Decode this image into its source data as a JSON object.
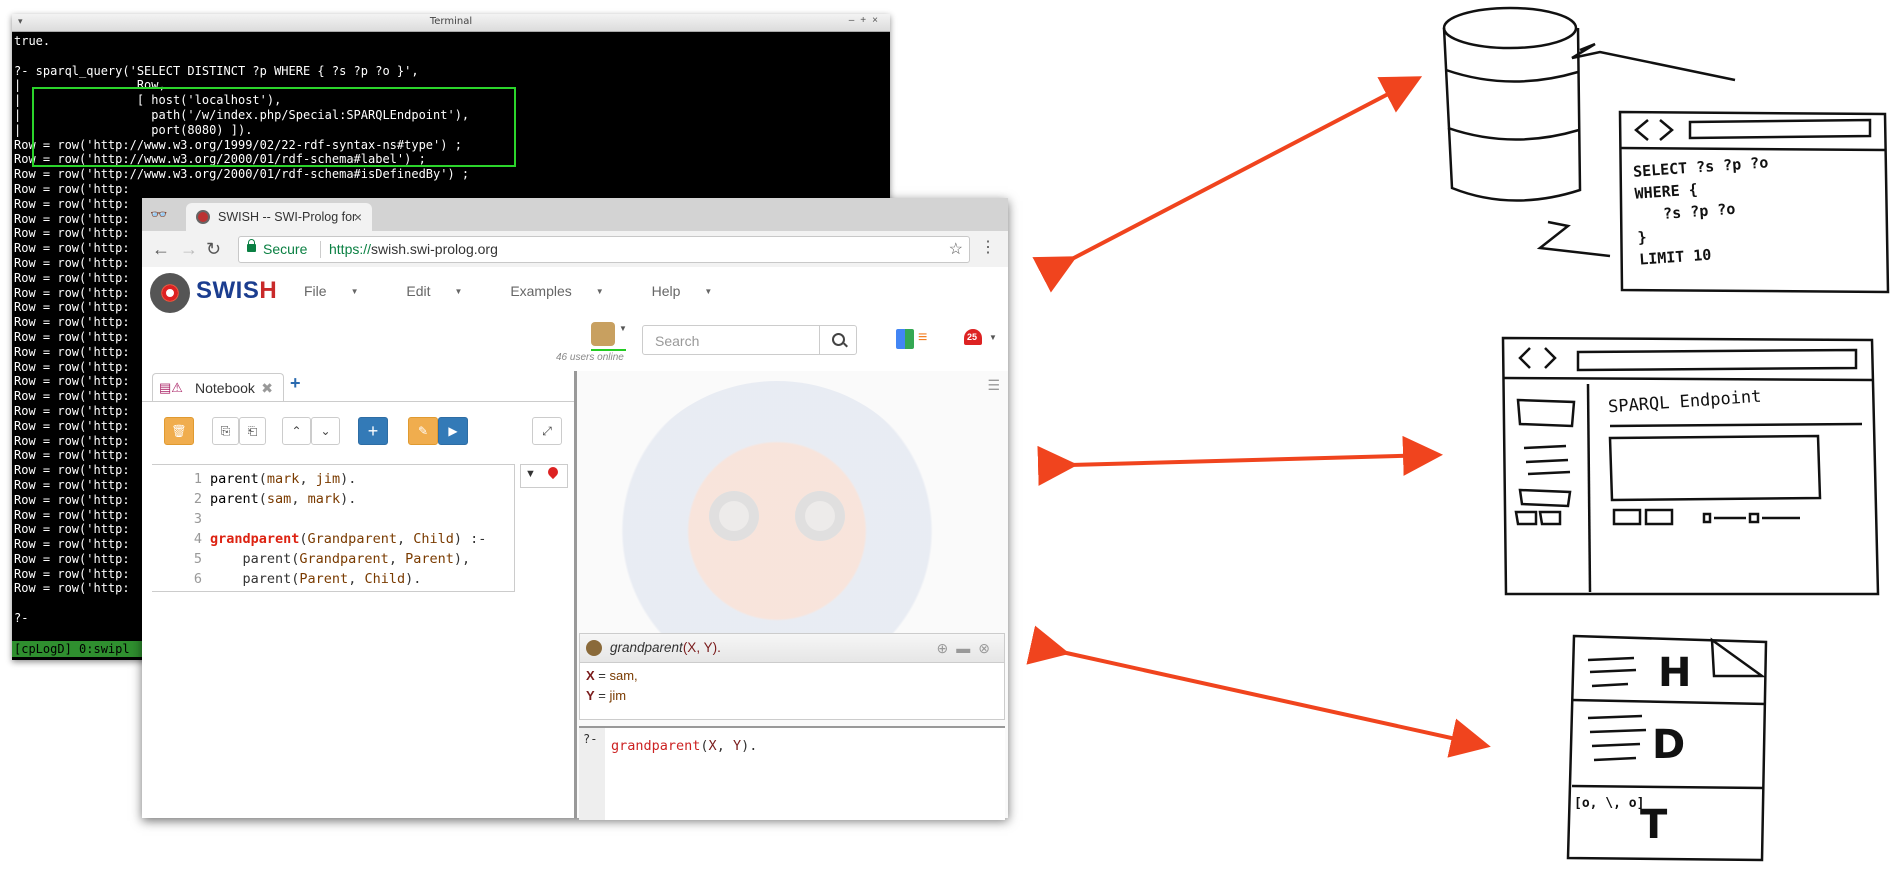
{
  "terminal": {
    "title": "Terminal",
    "lines": [
      "true.",
      "",
      "?- sparql_query('SELECT DISTINCT ?p WHERE { ?s ?p ?o }',",
      "|                Row,",
      "|                [ host('localhost'),",
      "|                  path('/w/index.php/Special:SPARQLEndpoint'),",
      "|                  port(8080) ]).",
      "Row = row('http://www.w3.org/1999/02/22-rdf-syntax-ns#type') ;",
      "Row = row('http://www.w3.org/2000/01/rdf-schema#label') ;",
      "Row = row('http://www.w3.org/2000/01/rdf-schema#isDefinedBy') ;",
      "Row = row('http:",
      "Row = row('http:",
      "Row = row('http:",
      "Row = row('http:",
      "Row = row('http:",
      "Row = row('http:",
      "Row = row('http:",
      "Row = row('http:",
      "Row = row('http:",
      "Row = row('http:",
      "Row = row('http:",
      "Row = row('http:",
      "Row = row('http:",
      "Row = row('http:",
      "Row = row('http:",
      "Row = row('http:",
      "Row = row('http:",
      "Row = row('http:",
      "Row = row('http:",
      "Row = row('http:",
      "Row = row('http:",
      "Row = row('http:",
      "Row = row('http:",
      "Row = row('http:",
      "Row = row('http:",
      "Row = row('http:",
      "Row = row('http:",
      "Row = row('http:",
      "",
      "?-"
    ],
    "status": "[cpLogD] 0:swipl"
  },
  "browser": {
    "tab_title": "SWISH -- SWI-Prolog for",
    "secure_label": "Secure",
    "url_scheme": "https://",
    "url_host": "swish.swi-prolog.org"
  },
  "swish": {
    "logo_sw": "SWIS",
    "logo_h": "H",
    "menu": [
      "File",
      "Edit",
      "Examples",
      "Help"
    ],
    "users_online": "46 users online",
    "search_placeholder": "Search",
    "notification_count": "25",
    "notebook_tab": "Notebook",
    "code": [
      {
        "n": "1",
        "parts": [
          [
            "kw-pred",
            "parent"
          ],
          [
            "atom",
            "("
          ],
          [
            "var",
            "mark"
          ],
          [
            "atom",
            ", "
          ],
          [
            "var",
            "jim"
          ],
          [
            "atom",
            ")."
          ]
        ]
      },
      {
        "n": "2",
        "parts": [
          [
            "kw-pred",
            "parent"
          ],
          [
            "atom",
            "("
          ],
          [
            "var",
            "sam"
          ],
          [
            "atom",
            ", "
          ],
          [
            "var",
            "mark"
          ],
          [
            "atom",
            ")."
          ]
        ]
      },
      {
        "n": "3",
        "parts": []
      },
      {
        "n": "4",
        "parts": [
          [
            "kw-red",
            "grandparent"
          ],
          [
            "atom",
            "("
          ],
          [
            "var",
            "Grandparent"
          ],
          [
            "atom",
            ", "
          ],
          [
            "var",
            "Child"
          ],
          [
            "atom",
            ") :-"
          ]
        ]
      },
      {
        "n": "5",
        "parts": [
          [
            "atom",
            "    parent("
          ],
          [
            "var",
            "Grandparent"
          ],
          [
            "atom",
            ", "
          ],
          [
            "var",
            "Parent"
          ],
          [
            "atom",
            "),"
          ]
        ]
      },
      {
        "n": "6",
        "parts": [
          [
            "atom",
            "    parent("
          ],
          [
            "var",
            "Parent"
          ],
          [
            "atom",
            ", "
          ],
          [
            "var",
            "Child"
          ],
          [
            "atom",
            ")."
          ]
        ]
      }
    ],
    "query_title": "grandparent",
    "query_args": "(X, Y).",
    "answers": [
      {
        "var": "X",
        "value": "sam,"
      },
      {
        "var": "Y",
        "value": "jim"
      }
    ],
    "query_prompt": "?-",
    "query_input_pred": "grandparent",
    "query_input_x": "X",
    "query_input_y": "Y"
  },
  "sketch": {
    "sparql_text": "SELECT ?s ?p ?o\nWHERE {\n   ?s ?p ?o\n}\nLIMIT 10",
    "endpoint_title": "SPARQL Endpoint",
    "doc_letters": [
      "H",
      "D",
      "T"
    ],
    "doc_bottom_text": "[o, \\, o]"
  },
  "colors": {
    "arrow": "#f0441e",
    "terminal_highlight": "#2bd42b",
    "swish_blue": "#1b3d8f",
    "swish_red": "#c92a2a"
  }
}
